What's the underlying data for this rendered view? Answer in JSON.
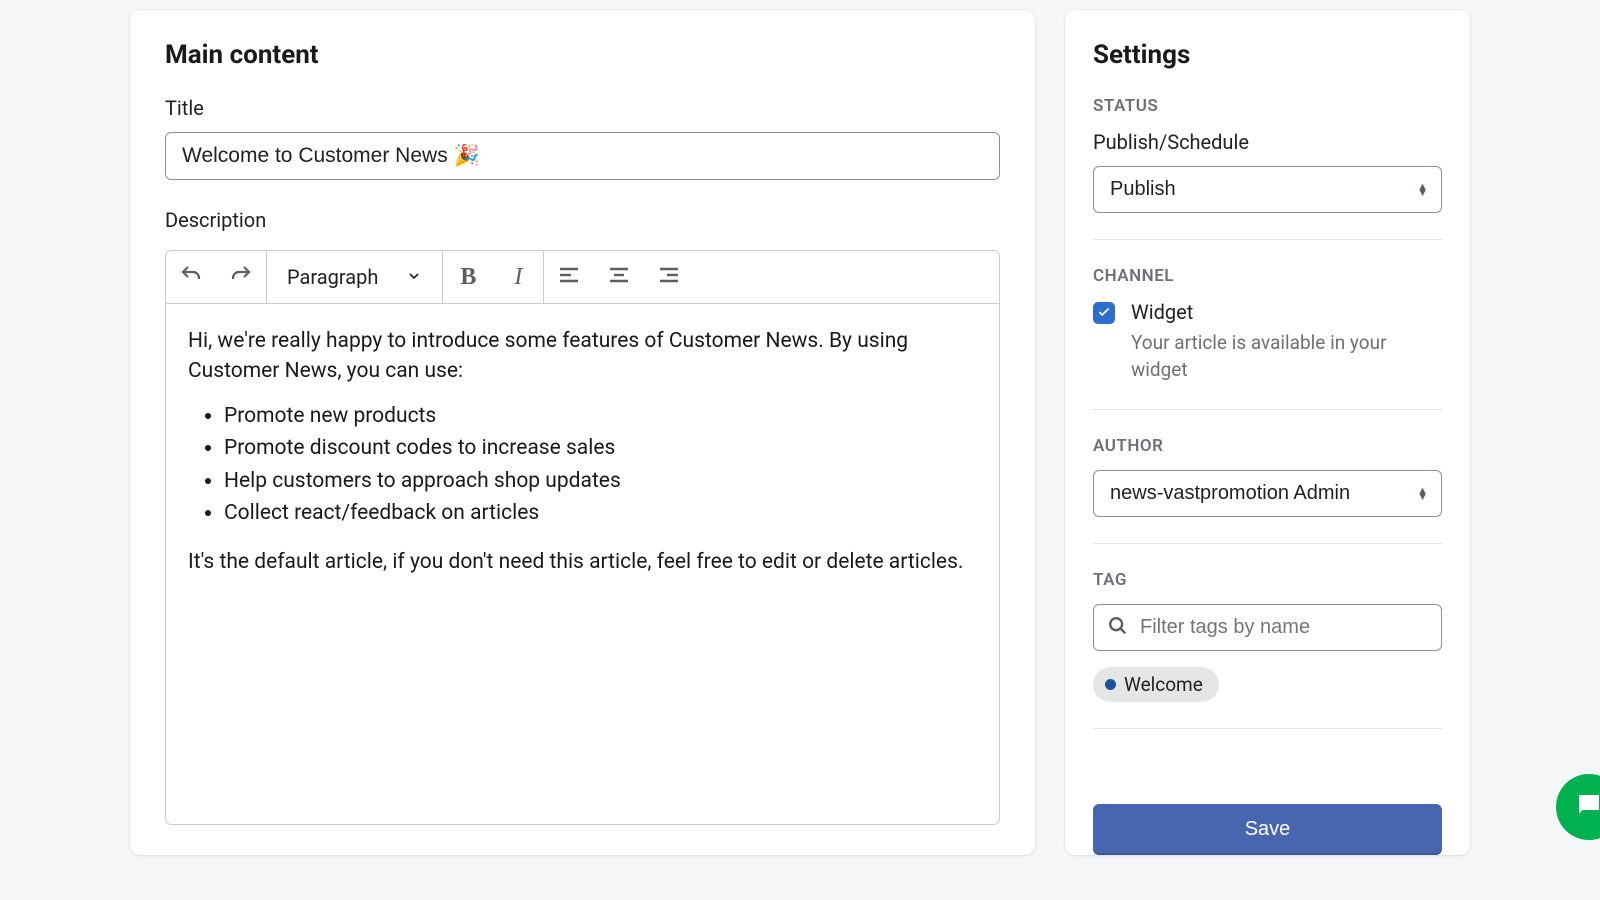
{
  "main": {
    "title": "Main content",
    "title_label": "Title",
    "title_value": "Welcome to Customer News 🎉",
    "description_label": "Description",
    "toolbar": {
      "paragraph_label": "Paragraph"
    },
    "body": {
      "intro": "Hi, we're really happy to introduce some features of Customer News. By using Customer News, you can use:",
      "bullets": [
        "Promote new products",
        "Promote discount codes to increase sales",
        "Help customers to approach shop updates",
        "Collect react/feedback on articles"
      ],
      "outro": "It's the default article, if you don't need this article, feel free to edit or delete articles."
    }
  },
  "settings": {
    "title": "Settings",
    "status": {
      "heading": "STATUS",
      "label": "Publish/Schedule",
      "value": "Publish"
    },
    "channel": {
      "heading": "CHANNEL",
      "option_label": "Widget",
      "option_help": "Your article is available in your widget"
    },
    "author": {
      "heading": "AUTHOR",
      "value": "news-vastpromotion Admin"
    },
    "tag": {
      "heading": "TAG",
      "placeholder": "Filter tags by name",
      "chips": [
        "Welcome"
      ]
    },
    "save_label": "Save"
  }
}
